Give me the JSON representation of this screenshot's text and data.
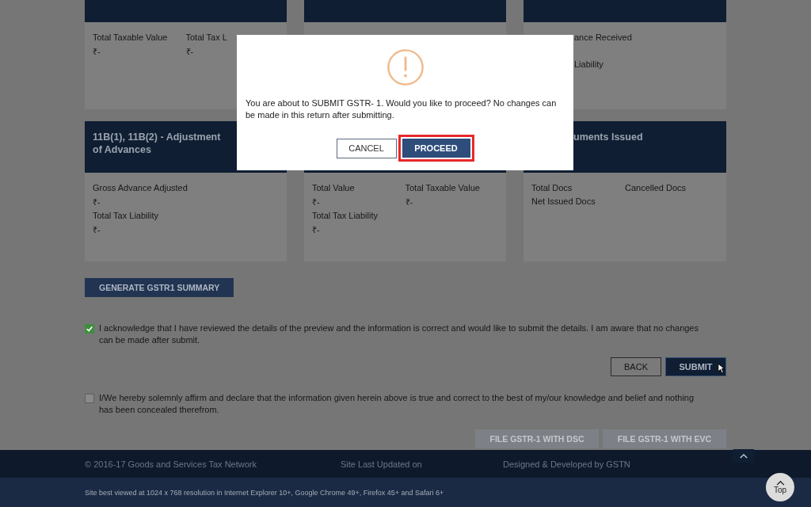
{
  "cards_top": [
    {
      "kind": "summary",
      "rows": [
        [
          {
            "label": "Total Taxable Value",
            "value": "₹-"
          },
          {
            "label": "Total Tax L",
            "value": "₹-"
          }
        ]
      ]
    },
    {
      "kind": "summary"
    },
    {
      "kind": "summary",
      "rows": [
        [
          {
            "label": "ance Received",
            "cut": true
          }
        ],
        [],
        [
          {
            "label": "Liability",
            "cut": true
          }
        ]
      ]
    }
  ],
  "cards_bottom": [
    {
      "header_lines": [
        "11B(1), 11B(2) - Adjustment",
        "of Advances"
      ],
      "rows": [
        [
          {
            "label": "Gross Advance Adjusted",
            "value": "₹-"
          }
        ],
        [
          {
            "label": "Total Tax Liability",
            "value": "₹-"
          }
        ]
      ]
    },
    {
      "rows": [
        [
          {
            "label": "Total Value",
            "value": "₹-"
          },
          {
            "label": "Total Taxable Value",
            "value": "₹-"
          }
        ],
        [
          {
            "label": "Total Tax Liability",
            "value": "₹-"
          }
        ]
      ]
    },
    {
      "header_lines": [
        "uments Issued"
      ],
      "header_cut": true,
      "rows": [
        [
          {
            "label": "Total Docs"
          },
          {
            "label": "Cancelled Docs"
          }
        ],
        [
          {
            "label": "Net Issued Docs"
          }
        ]
      ]
    }
  ],
  "generate_button": "GENERATE GSTR1 SUMMARY",
  "acknowledge": {
    "checked": true,
    "text": "I acknowledge that I have reviewed the details of the preview and the information is correct and would like to submit the details. I am aware that no changes can be made after submit."
  },
  "back_button": "BACK",
  "submit_button": "SUBMIT",
  "declaration": {
    "checked": false,
    "text": "I/We hereby solemnly affirm and declare that the information given herein above is true and correct to the best of my/our knowledge and belief and nothing has been concealed therefrom."
  },
  "file_buttons": [
    {
      "label": "FILE GSTR-1 WITH DSC",
      "disabled": true
    },
    {
      "label": "FILE GSTR-1 WITH EVC",
      "disabled": true
    }
  ],
  "footer": {
    "copyright": "© 2016-17 Goods and Services Tax Network",
    "updated": "Site Last Updated on",
    "designed": "Designed & Developed by GSTN",
    "best_viewed": "Site best viewed at 1024 x 768 resolution in Internet Explorer 10+, Google Chrome 49+, Firefox 45+ and Safari 6+",
    "top_button": "Top"
  },
  "dialog": {
    "message": "You are about to SUBMIT GSTR- 1. Would you like to proceed? No changes can be made in this return after submitting.",
    "cancel": "CANCEL",
    "proceed": "PROCEED"
  }
}
